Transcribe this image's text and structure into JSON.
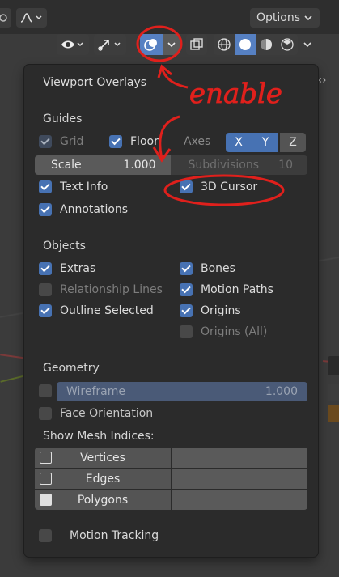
{
  "header": {
    "options_label": "Options",
    "options_arrow": "⌄"
  },
  "panel": {
    "title": "Viewport Overlays",
    "guides": {
      "label": "Guides",
      "grid": {
        "label": "Grid",
        "checked": true,
        "enabled": false
      },
      "floor": {
        "label": "Floor",
        "checked": true
      },
      "axes_label": "Axes",
      "axes": [
        "X",
        "Y",
        "Z"
      ],
      "scale": {
        "label": "Scale",
        "value": "1.000"
      },
      "subdivisions": {
        "label": "Subdivisions",
        "value": "10"
      },
      "text_info": {
        "label": "Text Info",
        "checked": true
      },
      "cursor_3d": {
        "label": "3D Cursor",
        "checked": true
      },
      "annotations": {
        "label": "Annotations",
        "checked": true
      }
    },
    "objects": {
      "label": "Objects",
      "left": [
        {
          "label": "Extras",
          "checked": true,
          "enabled": true
        },
        {
          "label": "Relationship Lines",
          "checked": false,
          "enabled": false
        },
        {
          "label": "Outline Selected",
          "checked": true,
          "enabled": true
        }
      ],
      "right": [
        {
          "label": "Bones",
          "checked": true,
          "enabled": true
        },
        {
          "label": "Motion Paths",
          "checked": true,
          "enabled": true
        },
        {
          "label": "Origins",
          "checked": true,
          "enabled": true
        },
        {
          "label": "Origins (All)",
          "checked": false,
          "enabled": false
        }
      ]
    },
    "geometry": {
      "label": "Geometry",
      "wireframe": {
        "label": "Wireframe",
        "value": "1.000",
        "checked": false
      },
      "face_orientation": {
        "label": "Face Orientation",
        "checked": false
      }
    },
    "mesh_indices": {
      "label": "Show Mesh Indices:",
      "rows": [
        "Vertices",
        "Edges",
        "Polygons"
      ]
    },
    "motion_tracking": {
      "label": "Motion Tracking",
      "checked": false
    }
  },
  "annotation": {
    "text": "enable",
    "color": "#e0201c"
  },
  "colors": {
    "accent": "#4772b3",
    "panel_bg": "#2b2b2b"
  }
}
